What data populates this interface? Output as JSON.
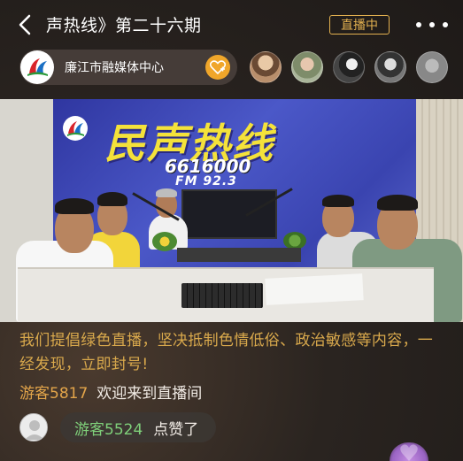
{
  "header": {
    "title": "声热线》第二十六期",
    "live_status": "直播中"
  },
  "host": {
    "name": "廉江市融媒体中心"
  },
  "video": {
    "show_title": "民声热线",
    "phone": "6616000",
    "frequency": "FM 92.3"
  },
  "chat": {
    "notice": "我们提倡绿色直播，坚决抵制色情低俗、政治敏感等内容，一经发现，立即封号!",
    "welcome": {
      "user": "游客5817",
      "text": "欢迎来到直播间"
    },
    "like": {
      "user": "游客5524",
      "text": "点赞了"
    }
  },
  "colors": {
    "accent": "#e3b150",
    "notice": "#d9a94c",
    "like_user": "#7fd07a",
    "follow": "#f0a62a"
  },
  "icons": {
    "back": "chevron-left-icon",
    "more": "more-dots-icon",
    "follow": "heart-plus-icon",
    "like": "heart-icon"
  }
}
